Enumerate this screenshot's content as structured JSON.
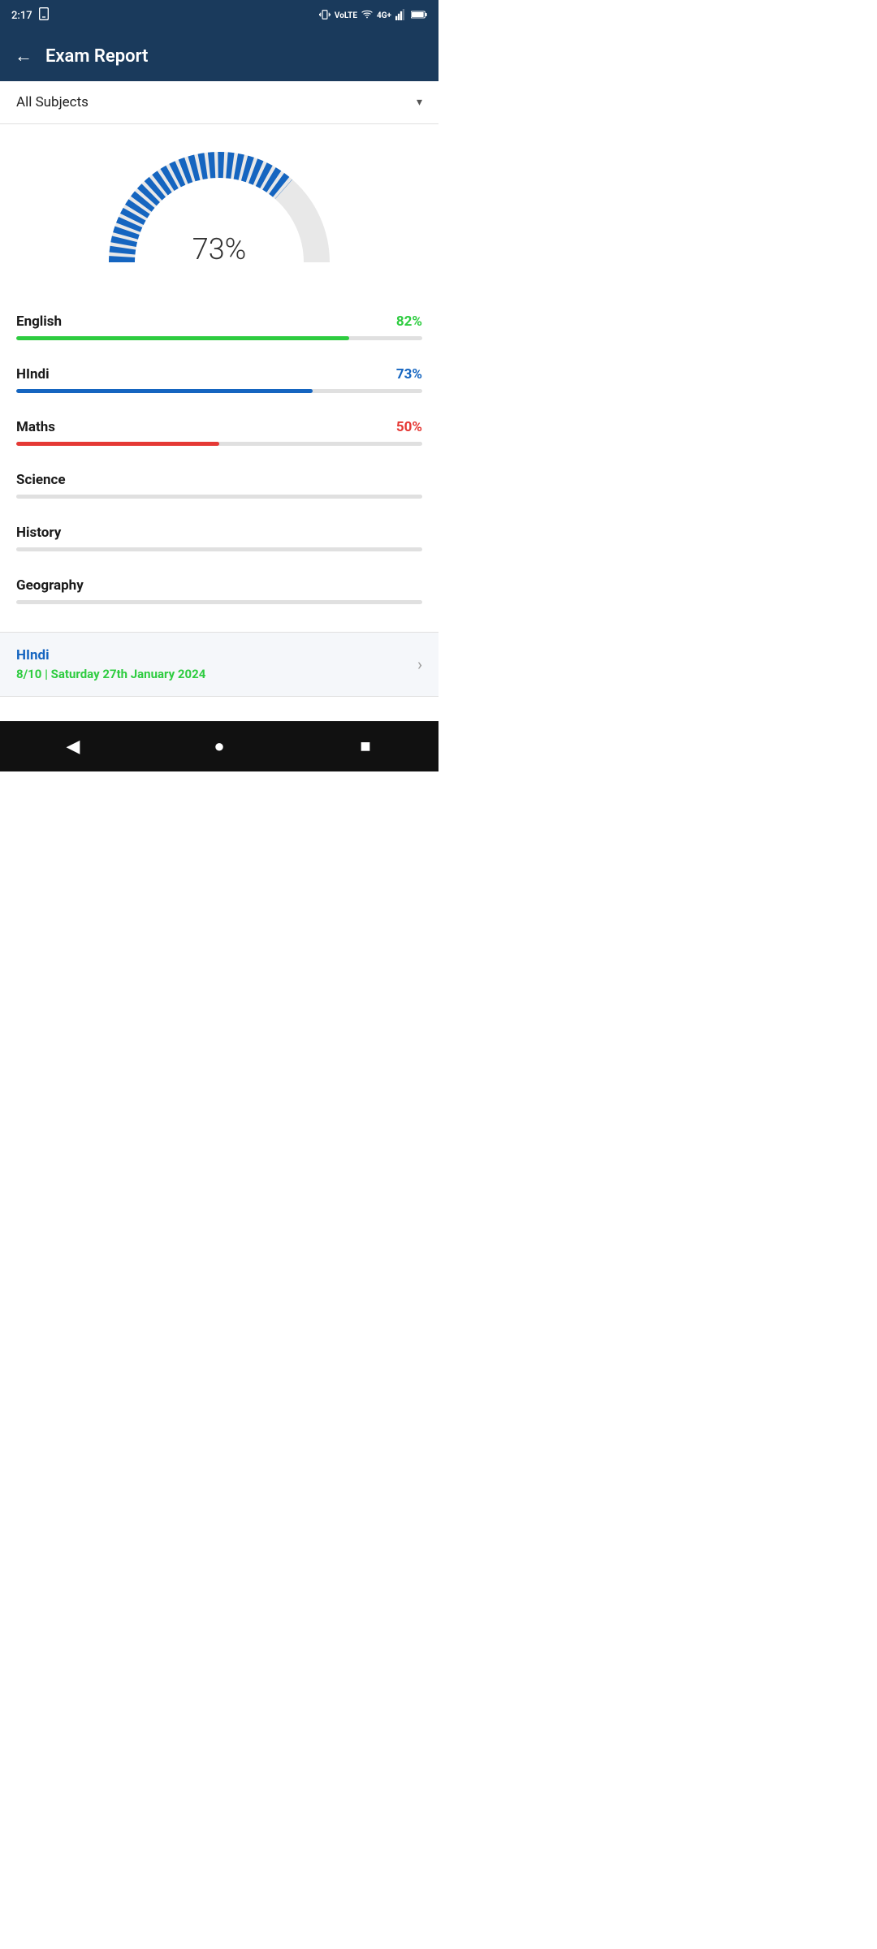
{
  "statusBar": {
    "time": "2:17",
    "icons": [
      "phone-icon",
      "vibrate-icon",
      "volte-icon",
      "wifi-icon",
      "4g-icon",
      "signal-icon",
      "battery-icon"
    ]
  },
  "appBar": {
    "backLabel": "←",
    "title": "Exam Report"
  },
  "subjectDropdown": {
    "label": "All Subjects",
    "chevron": "▾"
  },
  "gauge": {
    "percent": 73,
    "displayText": "73%"
  },
  "subjects": [
    {
      "name": "English",
      "percent": 82,
      "displayPercent": "82%",
      "colorClass": "color-green",
      "fillClass": "fill-green"
    },
    {
      "name": "HIndi",
      "percent": 73,
      "displayPercent": "73%",
      "colorClass": "color-blue",
      "fillClass": "fill-blue"
    },
    {
      "name": "Maths",
      "percent": 50,
      "displayPercent": "50%",
      "colorClass": "color-red",
      "fillClass": "fill-red"
    },
    {
      "name": "Science",
      "percent": 0,
      "displayPercent": "",
      "colorClass": "",
      "fillClass": "fill-gray"
    },
    {
      "name": "History",
      "percent": 0,
      "displayPercent": "",
      "colorClass": "",
      "fillClass": "fill-gray"
    },
    {
      "name": "Geography",
      "percent": 0,
      "displayPercent": "",
      "colorClass": "",
      "fillClass": "fill-gray"
    }
  ],
  "bottomCard": {
    "subject": "HIndi",
    "score": "8/10",
    "scoreSuffix": " | Saturday 27th January 2024",
    "chevron": "›"
  },
  "navBar": {
    "back": "◀",
    "home": "●",
    "recent": "■"
  }
}
